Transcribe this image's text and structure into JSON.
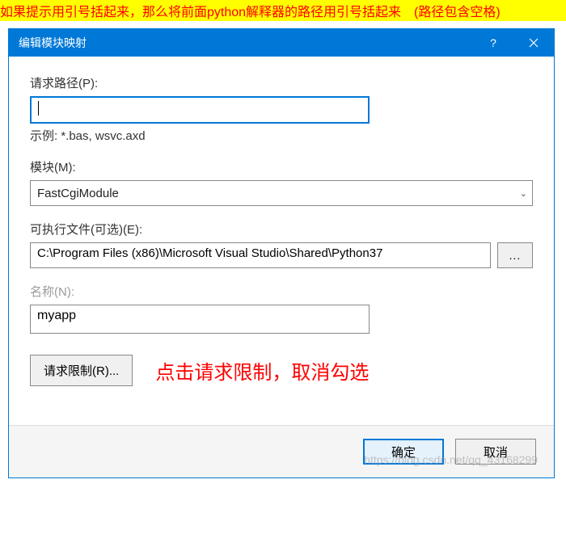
{
  "annotation": "如果提示用引号括起来，那么将前面python解释器的路径用引号括起来　(路径包含空格)",
  "dialog": {
    "title": "编辑模块映射",
    "path": {
      "label": "请求路径(P):",
      "value": "",
      "example": "示例: *.bas, wsvc.axd"
    },
    "module": {
      "label": "模块(M):",
      "value": "FastCgiModule"
    },
    "executable": {
      "label": "可执行文件(可选)(E):",
      "value": "C:\\Program Files (x86)\\Microsoft Visual Studio\\Shared\\Python37",
      "browse": "..."
    },
    "name": {
      "label": "名称(N):",
      "value": "myapp"
    },
    "restrict_button": "请求限制(R)...",
    "note": "点击请求限制，取消勾选",
    "ok": "确定",
    "cancel": "取消"
  },
  "watermark": "https://blog.csdn.net/qq_43168299"
}
